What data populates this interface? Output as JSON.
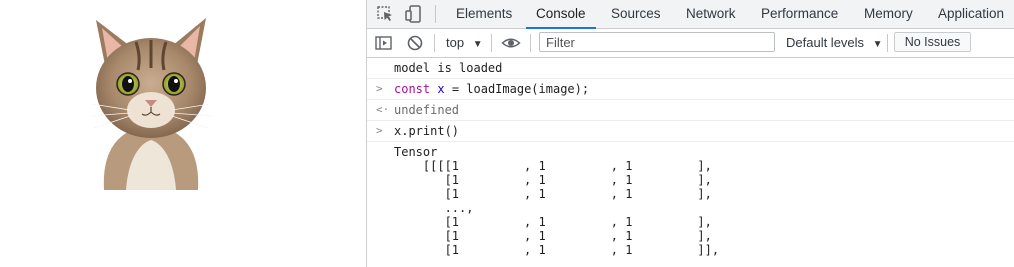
{
  "devtools": {
    "tabs": [
      "Elements",
      "Console",
      "Sources",
      "Network",
      "Performance",
      "Memory",
      "Application"
    ],
    "active_tab": "Console",
    "toolbar": {
      "context": "top",
      "filter_placeholder": "Filter",
      "levels": "Default levels",
      "issues": "No Issues"
    },
    "console": {
      "log1": "model is loaded",
      "input1": {
        "keyword": "const",
        "variable": "x",
        "rest": " = loadImage(image);"
      },
      "result1": "undefined",
      "input2": "x.print()",
      "output_title": "Tensor",
      "tensor_lines": [
        "    [[[[1         , 1         , 1         ],",
        "       [1         , 1         , 1         ],",
        "       [1         , 1         , 1         ],",
        "       ...,",
        "       [1         , 1         , 1         ],",
        "       [1         , 1         , 1         ],",
        "       [1         , 1         , 1         ]],"
      ]
    }
  },
  "colors": {
    "accent": "#1a73e8",
    "keyword": "#aa0d91",
    "variable": "#1c00cf"
  },
  "icons": [
    "cat-image",
    "inspect-icon",
    "device-toolbar-icon",
    "sidebar-toggle-icon",
    "clear-console-icon",
    "eye-icon",
    "dropdown-arrow-icon"
  ]
}
